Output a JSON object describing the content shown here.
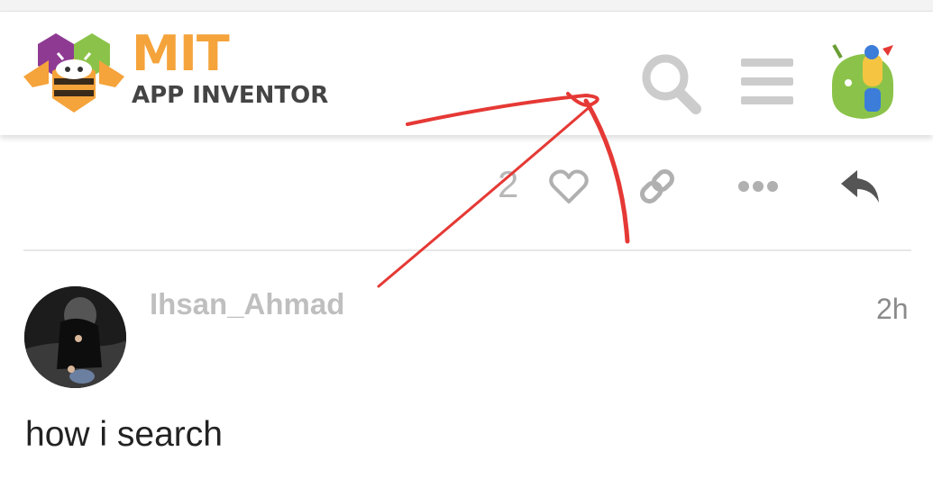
{
  "header": {
    "logo_title": "MIT",
    "logo_subtitle": "APP INVENTOR",
    "search_icon": "search-icon",
    "menu_icon": "hamburger-menu-icon",
    "user_avatar": "android-user-avatar"
  },
  "post_actions": {
    "like_count": "2",
    "like_icon": "heart-icon",
    "link_icon": "link-icon",
    "more_icon": "more-dots-icon",
    "reply_icon": "reply-arrow-icon"
  },
  "post": {
    "username": "Ihsan_Ahmad",
    "time": "2h",
    "body": "how i search"
  },
  "colors": {
    "logo_orange": "#f5a33b",
    "logo_purple": "#8e3a93",
    "logo_green": "#8bc34a",
    "icon_gray": "#cccccc",
    "annotation_red": "#e53935"
  }
}
